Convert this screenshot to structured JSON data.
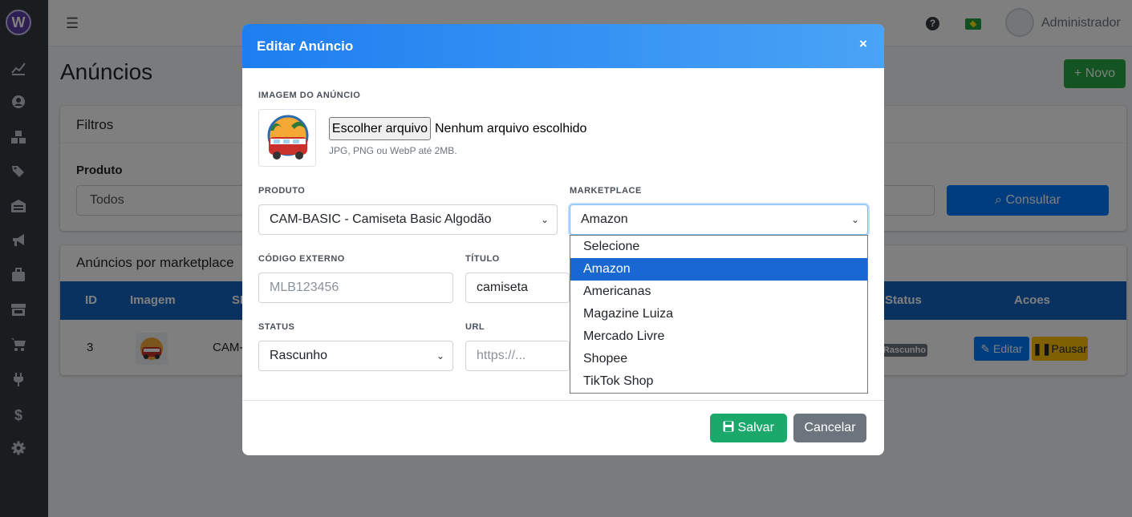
{
  "sidebar": {
    "logo": "W",
    "icons": [
      "chart-line-icon",
      "user-circle-icon",
      "boxes-icon",
      "tags-icon",
      "warehouse-icon",
      "bullhorn-icon",
      "briefcase-icon",
      "store-icon",
      "cart-icon",
      "plug-icon",
      "dollar-icon",
      "gear-icon"
    ]
  },
  "topbar": {
    "user_name": "Administrador"
  },
  "page": {
    "title": "Anúncios",
    "new_button": "+ Novo",
    "filters": {
      "title": "Filtros",
      "product_label": "Produto",
      "product_value": "Todos",
      "search_button": "Consultar"
    },
    "listings": {
      "title": "Anúncios por marketplace",
      "columns": [
        "ID",
        "Imagem",
        "SKU",
        "Status",
        "Acoes"
      ],
      "row": {
        "id": "3",
        "sku": "CAM-",
        "status": "Rascunho",
        "edit_button": "Editar",
        "pause_button": "Pausar"
      }
    }
  },
  "modal": {
    "title": "Editar Anúncio",
    "close": "×",
    "image_label": "IMAGEM DO ANÚNCIO",
    "file_button": "Escolher arquivo",
    "file_status": "Nenhum arquivo escolhido",
    "file_help": "JPG, PNG ou WebP até 2MB.",
    "produto_label": "PRODUTO",
    "produto_value": "CAM-BASIC - Camiseta Basic Algodão",
    "marketplace_label": "MARKETPLACE",
    "marketplace_value": "Amazon",
    "marketplace_options": [
      "Selecione",
      "Amazon",
      "Americanas",
      "Magazine Luiza",
      "Mercado Livre",
      "Shopee",
      "TikTok Shop"
    ],
    "marketplace_selected_index": 1,
    "codigo_label": "CÓDIGO EXTERNO",
    "codigo_placeholder": "MLB123456",
    "titulo_label": "TÍTULO",
    "titulo_value": "camiseta",
    "status_label": "STATUS",
    "status_value": "Rascunho",
    "url_label": "URL",
    "url_placeholder": "https://...",
    "save_button": "Salvar",
    "cancel_button": "Cancelar"
  },
  "colors": {
    "sidebar": "#343a40",
    "header_gradient_start": "#1e7ef0",
    "header_gradient_end": "#4aa3f5",
    "primary": "#007bff",
    "success": "#1aa86b",
    "warning": "#ffc107",
    "secondary": "#6c757d",
    "table_header": "#1565c0",
    "dropdown_selected": "#1967d2"
  }
}
